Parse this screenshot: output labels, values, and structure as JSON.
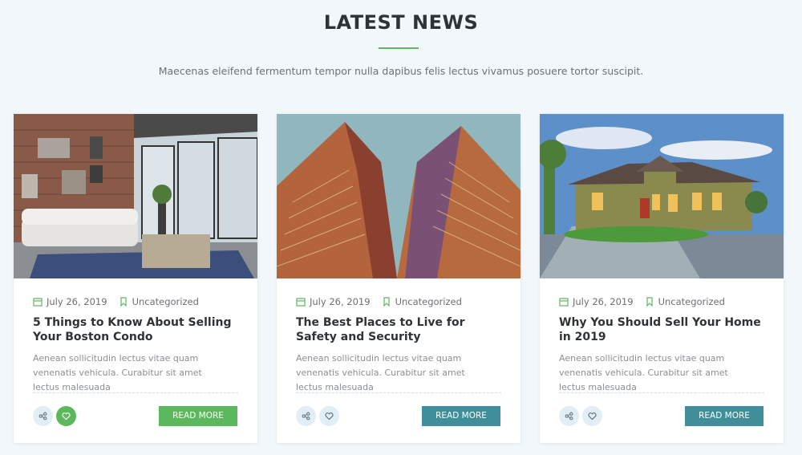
{
  "section": {
    "title": "LATEST NEWS",
    "subtitle": "Maecenas eleifend fermentum tempor nulla dapibus felis lectus vivamus posuere tortor suscipit."
  },
  "colors": {
    "accent_green": "#5cb85c",
    "teal_button": "#3f8e9a",
    "background": "#f1f7fb"
  },
  "icons": {
    "date": "calendar-icon",
    "category": "bookmark-icon",
    "share": "share-icon",
    "like": "heart-icon"
  },
  "posts": [
    {
      "date": "July 26, 2019",
      "category": "Uncategorized",
      "title": "5 Things to Know About Selling Your Boston Condo",
      "excerpt": "Aenean sollicitudin lectus vitae quam venenatis vehicula. Curabitur sit amet lectus malesuada",
      "read_more": "READ MORE"
    },
    {
      "date": "July 26, 2019",
      "category": "Uncategorized",
      "title": "The Best Places to Live for Safety and Security",
      "excerpt": "Aenean sollicitudin lectus vitae quam venenatis vehicula. Curabitur sit amet lectus malesuada",
      "read_more": "READ MORE"
    },
    {
      "date": "July 26, 2019",
      "category": "Uncategorized",
      "title": "Why You Should Sell Your Home in 2019",
      "excerpt": "Aenean sollicitudin lectus vitae quam venenatis vehicula. Curabitur sit amet lectus malesuada",
      "read_more": "READ MORE"
    }
  ]
}
